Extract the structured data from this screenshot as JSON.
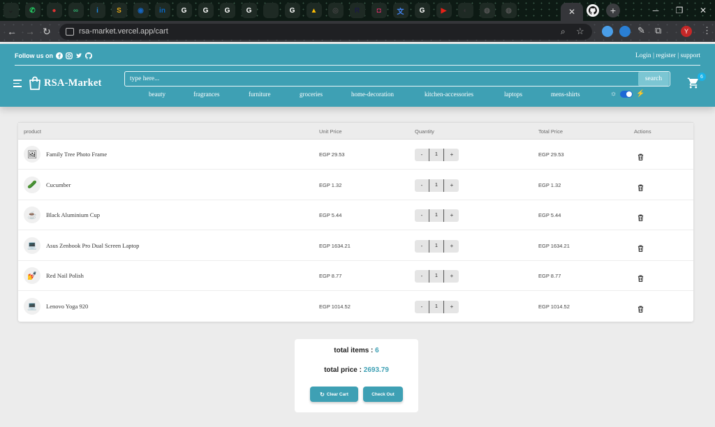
{
  "browser": {
    "url": "rsa-market.vercel.app/cart",
    "active_tab_close": "✕",
    "new_tab": "+",
    "tab_icons": [
      {
        "name": "chrome-menu-icon",
        "color": "#1c1c1c",
        "glyph": "⌄"
      },
      {
        "name": "whatsapp-icon",
        "color": "#25d366",
        "glyph": "✆"
      },
      {
        "name": "tab-red-icon",
        "color": "#d33",
        "glyph": "●"
      },
      {
        "name": "tab-green-icon",
        "color": "#2fa66a",
        "glyph": "∞"
      },
      {
        "name": "tab-blue-icon",
        "color": "#1e88e5",
        "glyph": "i"
      },
      {
        "name": "tab-yellow-icon",
        "color": "#e6a817",
        "glyph": "S"
      },
      {
        "name": "tab-ring-icon",
        "color": "#1565c0",
        "glyph": "◉"
      },
      {
        "name": "linkedin-icon",
        "color": "#0a66c2",
        "glyph": "in"
      },
      {
        "name": "google-icon",
        "color": "#ffffff",
        "glyph": "G"
      },
      {
        "name": "google-icon",
        "color": "#ffffff",
        "glyph": "G"
      },
      {
        "name": "google-icon",
        "color": "#ffffff",
        "glyph": "G"
      },
      {
        "name": "google-icon",
        "color": "#ffffff",
        "glyph": "G"
      },
      {
        "name": "tab-dark-icon",
        "color": "#1b3326",
        "glyph": " "
      },
      {
        "name": "google-icon",
        "color": "#ffffff",
        "glyph": "G"
      },
      {
        "name": "drive-icon",
        "color": "#fbbc04",
        "glyph": "▲"
      },
      {
        "name": "chatgpt-icon",
        "color": "#444",
        "glyph": "◎"
      },
      {
        "name": "tab-r-icon",
        "color": "#1a1a40",
        "glyph": "R"
      },
      {
        "name": "instagram-icon",
        "color": "#e1306c",
        "glyph": "◘"
      },
      {
        "name": "translate-icon",
        "color": "#4285f4",
        "glyph": "文"
      },
      {
        "name": "google-icon",
        "color": "#ffffff",
        "glyph": "G"
      },
      {
        "name": "youtube-icon",
        "color": "#e62117",
        "glyph": "▶"
      },
      {
        "name": "github-icon",
        "color": "#333",
        "glyph": "◐"
      },
      {
        "name": "globe-icon",
        "color": "#555",
        "glyph": "◍"
      },
      {
        "name": "globe-icon",
        "color": "#555",
        "glyph": "◍"
      }
    ]
  },
  "header": {
    "follow_label": "Follow us on",
    "auth": {
      "login": "Login",
      "register": "register",
      "support": "support",
      "separator": "|"
    },
    "brand": "RSA-Market",
    "search_placeholder": "type here...",
    "search_button": "search",
    "categories": [
      "beauty",
      "fragrances",
      "furniture",
      "groceries",
      "home-decoration",
      "kitchen-accessories",
      "laptops",
      "mens-shirts"
    ],
    "cart_count": "6"
  },
  "table": {
    "headers": {
      "product": "product",
      "unit_price": "Unit Price",
      "quantity": "Quantity",
      "total_price": "Total Price",
      "actions": "Actions"
    },
    "rows": [
      {
        "name": "Family Tree Photo Frame",
        "unit_price": "EGP 29.53",
        "qty": "1",
        "total": "EGP 29.53",
        "icon": "🖼"
      },
      {
        "name": "Cucumber",
        "unit_price": "EGP 1.32",
        "qty": "1",
        "total": "EGP 1.32",
        "icon": "🥒"
      },
      {
        "name": "Black Aluminium Cup",
        "unit_price": "EGP 5.44",
        "qty": "1",
        "total": "EGP 5.44",
        "icon": "☕"
      },
      {
        "name": "Asus Zenbook Pro Dual Screen Laptop",
        "unit_price": "EGP 1634.21",
        "qty": "1",
        "total": "EGP 1634.21",
        "icon": "💻"
      },
      {
        "name": "Red Nail Polish",
        "unit_price": "EGP 8.77",
        "qty": "1",
        "total": "EGP 8.77",
        "icon": "💅"
      },
      {
        "name": "Lenovo Yoga 920",
        "unit_price": "EGP 1014.52",
        "qty": "1",
        "total": "EGP 1014.52",
        "icon": "💻"
      }
    ],
    "minus": "-",
    "plus": "+"
  },
  "summary": {
    "total_items_label": "total items : ",
    "total_items": "6",
    "total_price_label": "total price : ",
    "total_price": "2693.79",
    "clear_button": "Clear Cart",
    "checkout_button": "Check Out"
  },
  "colors": {
    "accent": "#3ea0b4",
    "background": "#ececec"
  }
}
